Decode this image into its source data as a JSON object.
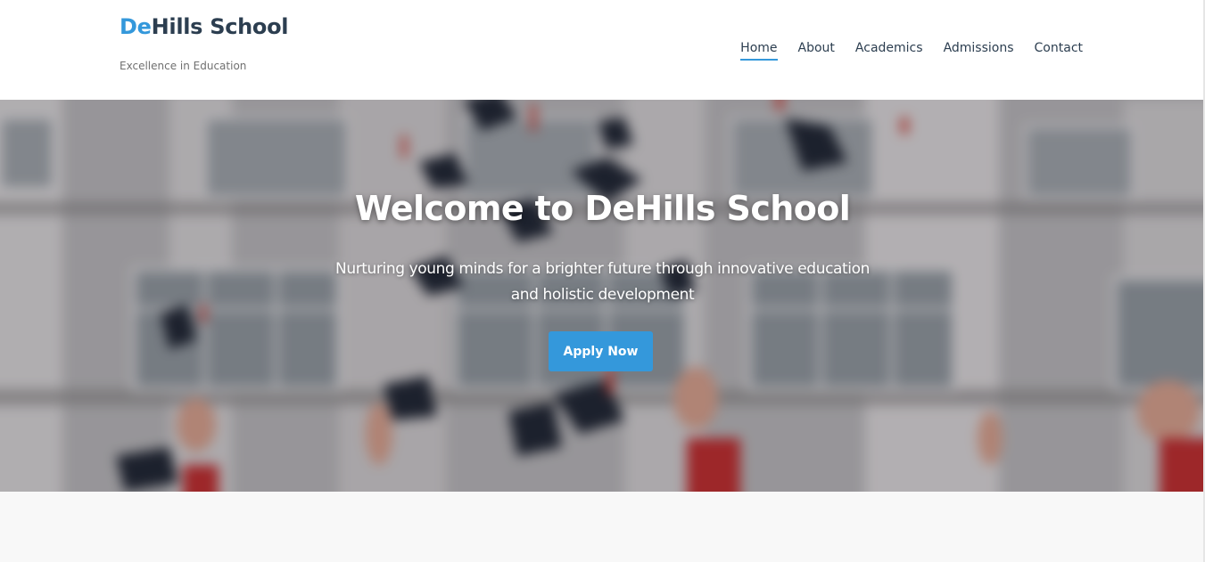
{
  "header": {
    "brand_accent": "De",
    "brand_rest": "Hills School",
    "tagline": "Excellence in Education"
  },
  "nav": {
    "items": [
      {
        "label": "Home",
        "active": true
      },
      {
        "label": "About",
        "active": false
      },
      {
        "label": "Academics",
        "active": false
      },
      {
        "label": "Admissions",
        "active": false
      },
      {
        "label": "Contact",
        "active": false
      }
    ]
  },
  "hero": {
    "title": "Welcome to DeHills School",
    "subtitle": "Nurturing young minds for a brighter future through innovative education and holistic development",
    "cta_label": "Apply Now"
  },
  "colors": {
    "accent": "#3498db",
    "brand_dark": "#2c3e50",
    "tagline": "#707070",
    "page_bg": "#f8f8f8"
  }
}
